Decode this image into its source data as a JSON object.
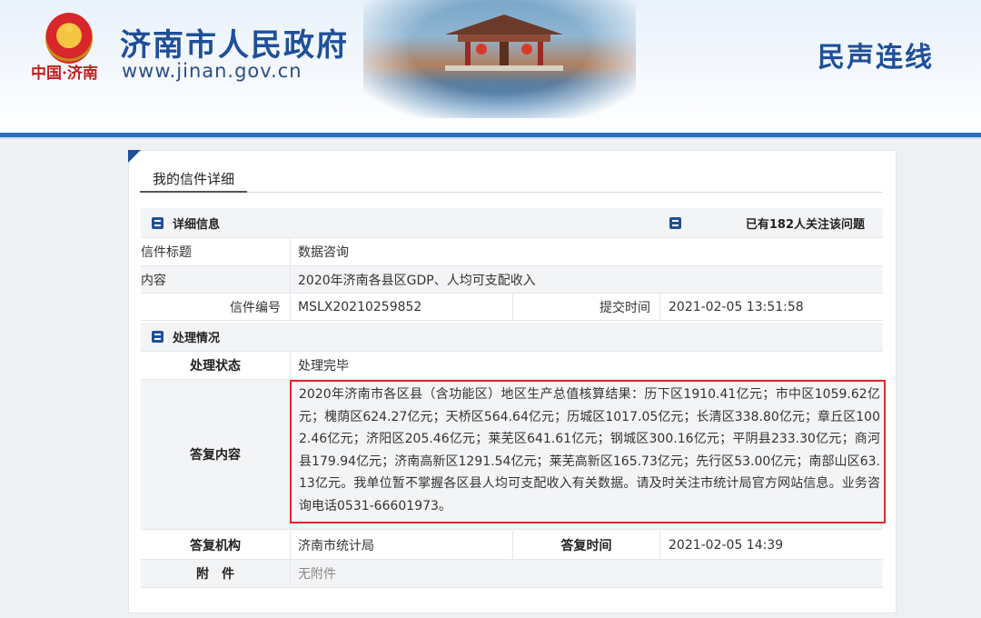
{
  "header": {
    "site_title": "济南市人民政府",
    "site_url": "www.jinan.gov.cn",
    "site_brand": "中国·济南",
    "section_name": "民声连线"
  },
  "page": {
    "tab_label": "我的信件详细"
  },
  "detail": {
    "section_title": "详细信息",
    "follow_count_text": "已有182人关注该问题",
    "title_label": "信件标题",
    "title_value": "数据咨询",
    "content_label": "内容",
    "content_value": "2020年济南各县区GDP、人均可支配收入",
    "number_label": "信件编号",
    "number_value": "MSLX20210259852",
    "submit_time_label": "提交时间",
    "submit_time_value": "2021-02-05 13:51:58"
  },
  "processing": {
    "section_title": "处理情况",
    "status_label": "处理状态",
    "status_value": "处理完毕",
    "reply_label": "答复内容",
    "reply_value": "2020年济南市各区县（含功能区）地区生产总值核算结果：历下区1910.41亿元；市中区1059.62亿元；槐荫区624.27亿元；天桥区564.64亿元；历城区1017.05亿元；长清区338.80亿元；章丘区1002.46亿元；济阳区205.46亿元；莱芜区641.61亿元；钢城区300.16亿元；平阴县233.30亿元；商河县179.94亿元；济南高新区1291.54亿元；莱芜高新区165.73亿元；先行区53.00亿元；南部山区63.13亿元。我单位暂不掌握各区县人均可支配收入有关数据。请及时关注市统计局官方网站信息。业务咨询电话0531-66601973。",
    "org_label": "答复机构",
    "org_value": "济南市统计局",
    "reply_time_label": "答复时间",
    "reply_time_value": "2021-02-05 14:39",
    "attachment_label": "附　件",
    "attachment_value": "无附件"
  },
  "colors": {
    "brand_blue": "#1f4f9a",
    "highlight_red": "#e0272b"
  }
}
